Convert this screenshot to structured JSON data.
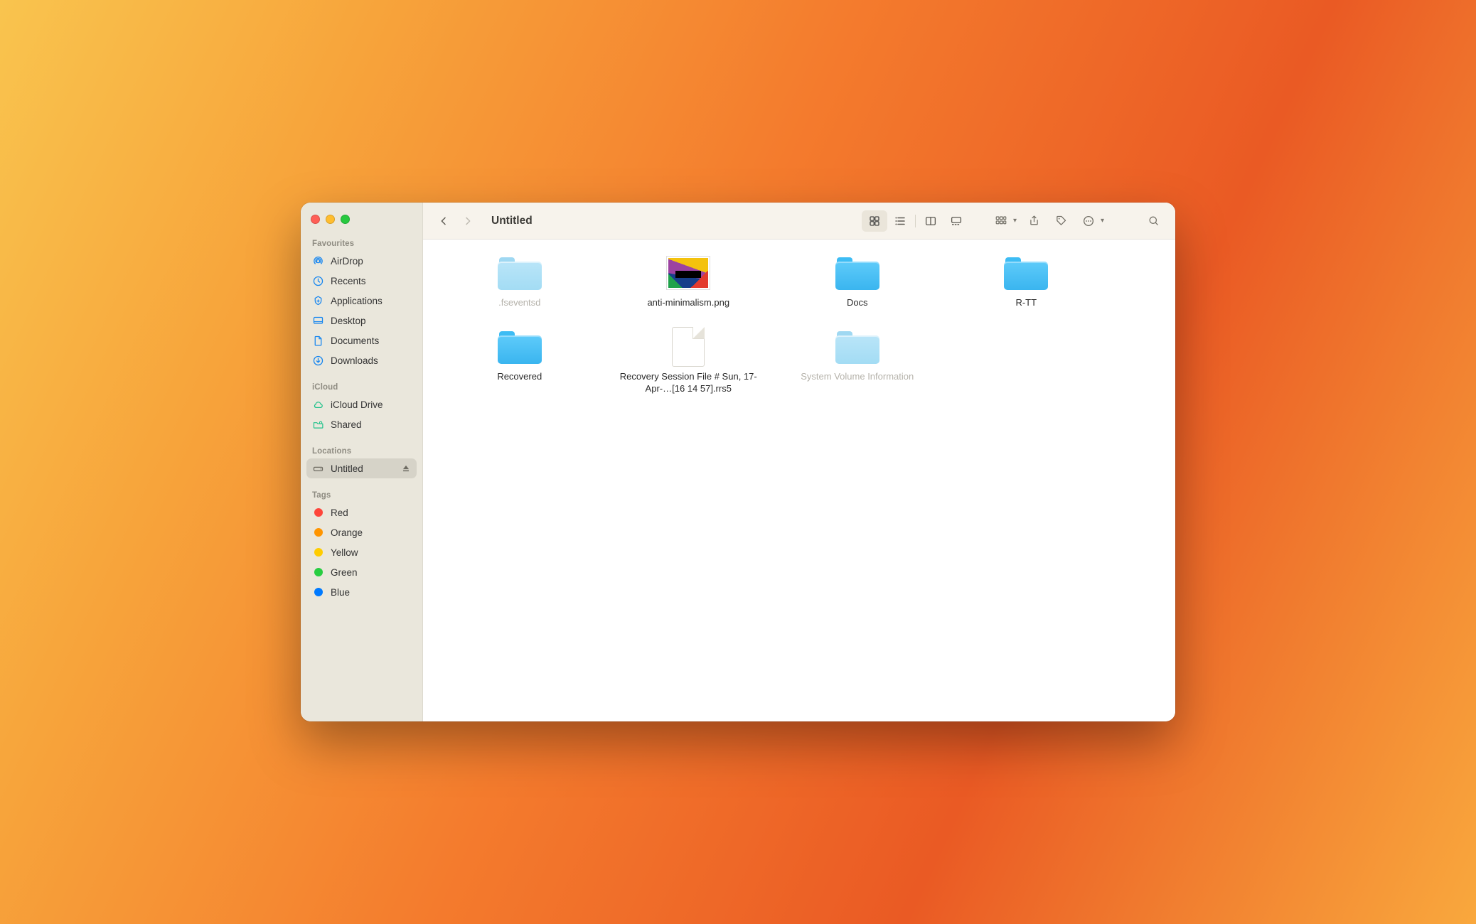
{
  "window": {
    "title": "Untitled"
  },
  "sidebar": {
    "section_favourites": "Favourites",
    "section_icloud": "iCloud",
    "section_locations": "Locations",
    "section_tags": "Tags",
    "favourites": [
      {
        "label": "AirDrop",
        "icon": "airdrop"
      },
      {
        "label": "Recents",
        "icon": "clock"
      },
      {
        "label": "Applications",
        "icon": "apps"
      },
      {
        "label": "Desktop",
        "icon": "desktop"
      },
      {
        "label": "Documents",
        "icon": "doc"
      },
      {
        "label": "Downloads",
        "icon": "download"
      }
    ],
    "icloud": [
      {
        "label": "iCloud Drive",
        "icon": "cloud"
      },
      {
        "label": "Shared",
        "icon": "sharedfolder"
      }
    ],
    "locations": [
      {
        "label": "Untitled",
        "icon": "drive",
        "eject": true,
        "active": true
      }
    ],
    "tags": [
      {
        "label": "Red",
        "color": "tag-red"
      },
      {
        "label": "Orange",
        "color": "tag-orange"
      },
      {
        "label": "Yellow",
        "color": "tag-yellow"
      },
      {
        "label": "Green",
        "color": "tag-green"
      },
      {
        "label": "Blue",
        "color": "tag-blue"
      }
    ]
  },
  "files": [
    {
      "name": ".fseventsd",
      "kind": "folder",
      "dim": true
    },
    {
      "name": "anti-minimalism.png",
      "kind": "image"
    },
    {
      "name": "Docs",
      "kind": "folder"
    },
    {
      "name": "R-TT",
      "kind": "folder"
    },
    {
      "name": "Recovered",
      "kind": "folder"
    },
    {
      "name": "Recovery Session File # Sun, 17-Apr-…[16 14 57].rrs5",
      "kind": "doc"
    },
    {
      "name": "System Volume Information",
      "kind": "folder",
      "dim": true
    }
  ]
}
